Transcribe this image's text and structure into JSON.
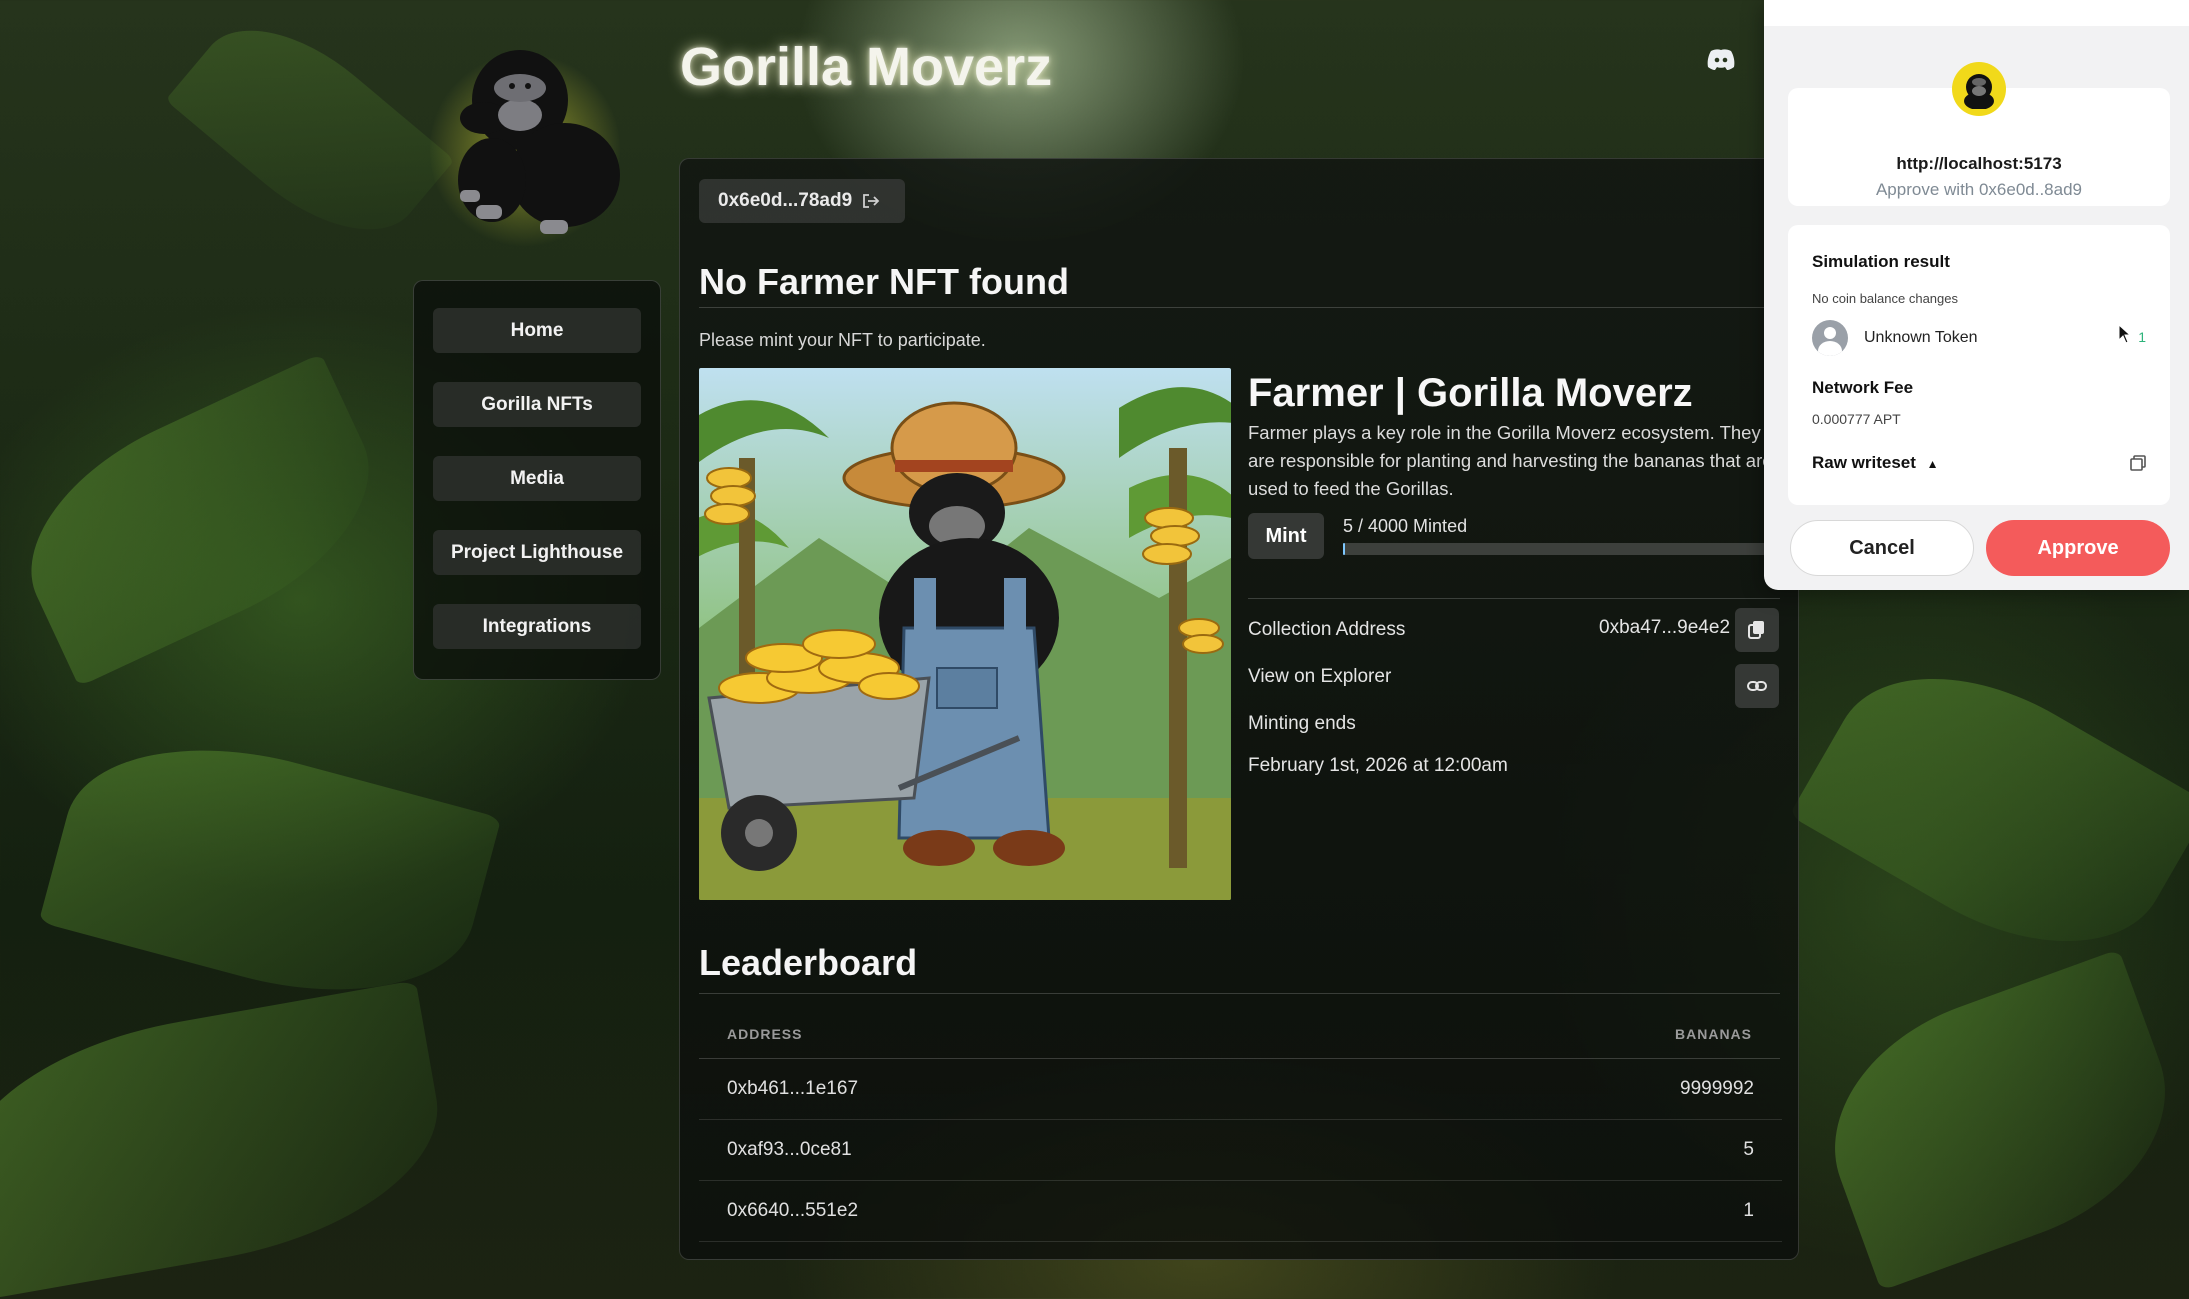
{
  "site": {
    "title": "Gorilla Moverz",
    "logo_icon": "gorilla-logo",
    "discord_icon": "discord-icon"
  },
  "nav": {
    "items": [
      {
        "label": "Home"
      },
      {
        "label": "Gorilla NFTs"
      },
      {
        "label": "Media"
      },
      {
        "label": "Project Lighthouse"
      },
      {
        "label": "Integrations"
      }
    ]
  },
  "account": {
    "address": "0x6e0d...78ad9"
  },
  "farmer": {
    "heading": "No Farmer NFT found",
    "hint": "Please mint your NFT to participate.",
    "nft_title": "Farmer | Gorilla Moverz",
    "description": "Farmer plays a key role in the Gorilla Moverz ecosystem. They are responsible for planting and harvesting the bananas that are used to feed the Gorillas.",
    "mint_label": "Mint",
    "minted_text": "5 / 4000 Minted",
    "minted_fraction": 0.00125,
    "collection_label": "Collection Address",
    "collection_value": "0xba47...9e4e2",
    "explorer_label": "View on Explorer",
    "minting_ends_label": "Minting ends",
    "minting_ends_value": "February 1st, 2026 at 12:00am"
  },
  "leaderboard": {
    "heading": "Leaderboard",
    "col_address": "ADDRESS",
    "col_bananas": "BANANAS",
    "rows": [
      {
        "address": "0xb461...1e167",
        "bananas": "9999992"
      },
      {
        "address": "0xaf93...0ce81",
        "bananas": "5"
      },
      {
        "address": "0x6640...551e2",
        "bananas": "1"
      }
    ]
  },
  "wallet": {
    "host": "http://localhost:5173",
    "approve_with": "Approve with 0x6e0d..8ad9",
    "simulation_title": "Simulation result",
    "no_changes": "No coin balance changes",
    "token_name": "Unknown Token",
    "token_amount": "1",
    "fee_title": "Network Fee",
    "fee_value": "0.000777 APT",
    "raw_writeset": "Raw writeset",
    "cancel_label": "Cancel",
    "approve_label": "Approve",
    "accent": "#f45b5b"
  }
}
